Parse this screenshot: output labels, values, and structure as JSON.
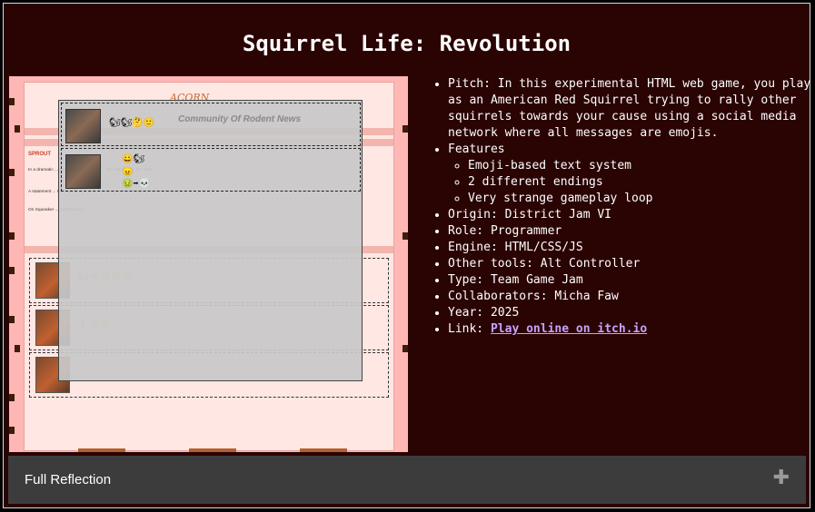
{
  "page": {
    "title": "Squirrel Life: Revolution"
  },
  "screenshot": {
    "logo": "ACORN",
    "header": "Community Of Rodent News",
    "sprout_label": "SPROUT",
    "paragraphs": [
      "In a dramatic ... the deaths of dozens ... the outcome of the case",
      "A statement ... thousands",
      "On Squeaker ... commitment."
    ],
    "overlay_emojis": [
      [
        "🐿",
        "🐿",
        "🤔",
        "🙂"
      ],
      [
        "😀",
        "🐿"
      ],
      [
        "😠"
      ],
      [
        "🤢",
        "➡",
        "💀"
      ]
    ],
    "feed_emojis": [
      [
        "🐿",
        "💀",
        "🤢",
        "🤢",
        "🤢"
      ],
      [
        "🌡",
        "🙂",
        "🙂"
      ],
      [
        "⚪",
        "⬜"
      ]
    ]
  },
  "info": {
    "pitch": "Pitch: In this experimental HTML web game, you play as an American Red Squirrel trying to rally other squirrels towards your cause using a social media network where all messages are emojis.",
    "features_label": "Features",
    "features": [
      "Emoji-based text system",
      "2 different endings",
      "Very strange gameplay loop"
    ],
    "origin": "Origin: District Jam VI",
    "role": "Role: Programmer",
    "engine": "Engine: HTML/CSS/JS",
    "other_tools": "Other tools: Alt Controller",
    "type": "Type: Team Game Jam",
    "collaborators": "Collaborators: Micha Faw",
    "year": "Year: 2025",
    "link_prefix": "Link: ",
    "link_text": "Play online on itch.io"
  },
  "accordion": {
    "label": "Full Reflection",
    "icon": "plus-icon"
  },
  "colors": {
    "background": "#2a0303",
    "link": "#c5a4ff",
    "accordion": "#3c3c3c",
    "thumb_bg": "#ffb7b5"
  }
}
